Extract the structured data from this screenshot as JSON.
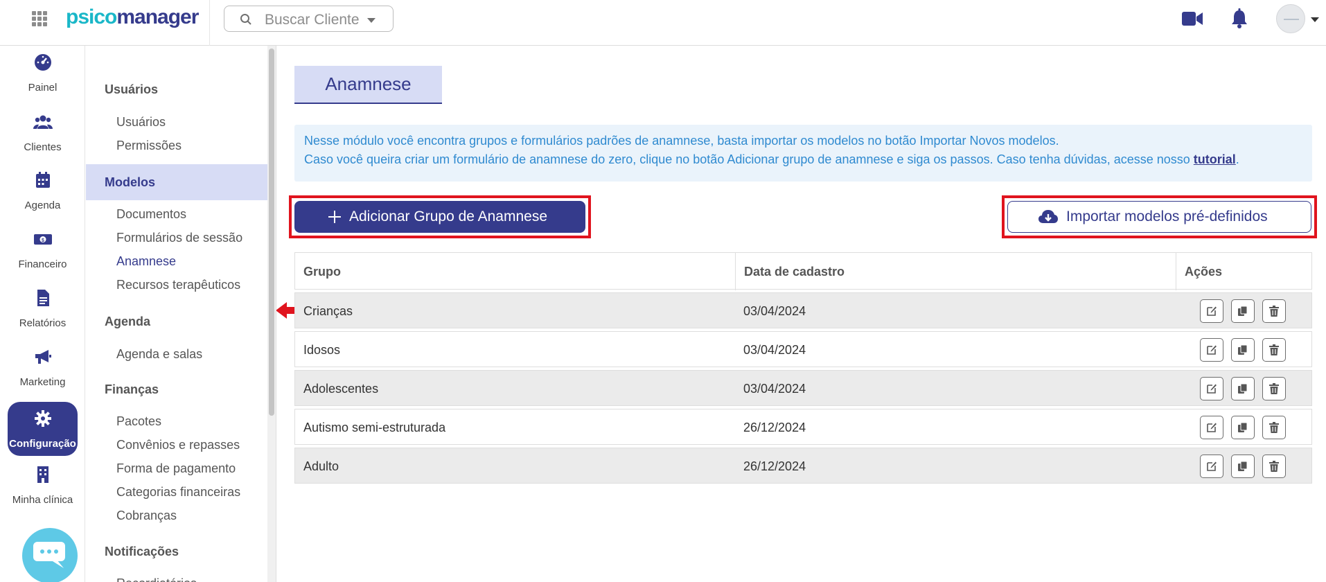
{
  "topbar": {
    "logo_part1": "psico",
    "logo_part2": "manager",
    "search_placeholder": "Buscar Cliente"
  },
  "rail": {
    "items": [
      {
        "label": "Painel",
        "icon": "gauge-icon"
      },
      {
        "label": "Clientes",
        "icon": "users-icon"
      },
      {
        "label": "Agenda",
        "icon": "calendar-icon"
      },
      {
        "label": "Financeiro",
        "icon": "money-icon"
      },
      {
        "label": "Relatórios",
        "icon": "document-icon"
      },
      {
        "label": "Marketing",
        "icon": "megaphone-icon"
      },
      {
        "label": "Configuração",
        "icon": "gear-icon",
        "active": true
      },
      {
        "label": "Minha clínica",
        "icon": "building-icon"
      }
    ]
  },
  "settings_nav": {
    "sections": [
      {
        "title": "Usuários",
        "items": [
          "Usuários",
          "Permissões"
        ]
      },
      {
        "title": "Modelos",
        "items": [
          "Documentos",
          "Formulários de sessão",
          "Anamnese",
          "Recursos terapêuticos"
        ]
      },
      {
        "title": "Agenda",
        "items": [
          "Agenda e salas"
        ]
      },
      {
        "title": "Finanças",
        "items": [
          "Pacotes",
          "Convênios e repasses",
          "Forma de pagamento",
          "Categorias financeiras",
          "Cobranças"
        ]
      },
      {
        "title": "Notificações",
        "items": [
          "Recordiatórios"
        ]
      }
    ]
  },
  "main": {
    "title": "Anamnese",
    "info_line1": "Nesse módulo você encontra grupos e formulários padrões de anamnese, basta importar os modelos no botão Importar Novos modelos.",
    "info_line2": "Caso você queira criar um formulário de anamnese do zero, clique no botão Adicionar grupo de anamnese e siga os passos. Caso tenha dúvidas, acesse nosso",
    "info_link": "tutorial",
    "info_end": ".",
    "add_button": "Adicionar Grupo de Anamnese",
    "import_button": "Importar modelos pré-definidos",
    "highlight_color": "#e0141e",
    "accent_color": "#353b8c"
  },
  "table": {
    "headers": [
      "Grupo",
      "Data de cadastro",
      "Ações"
    ],
    "rows": [
      {
        "grupo": "Crianças",
        "data": "03/04/2024"
      },
      {
        "grupo": "Idosos",
        "data": "03/04/2024"
      },
      {
        "grupo": "Adolescentes",
        "data": "03/04/2024"
      },
      {
        "grupo": "Autismo semi-estruturada",
        "data": "26/12/2024"
      },
      {
        "grupo": "Adulto",
        "data": "26/12/2024"
      }
    ],
    "row_actions": [
      "edit-icon",
      "copy-icon",
      "trash-icon"
    ]
  }
}
